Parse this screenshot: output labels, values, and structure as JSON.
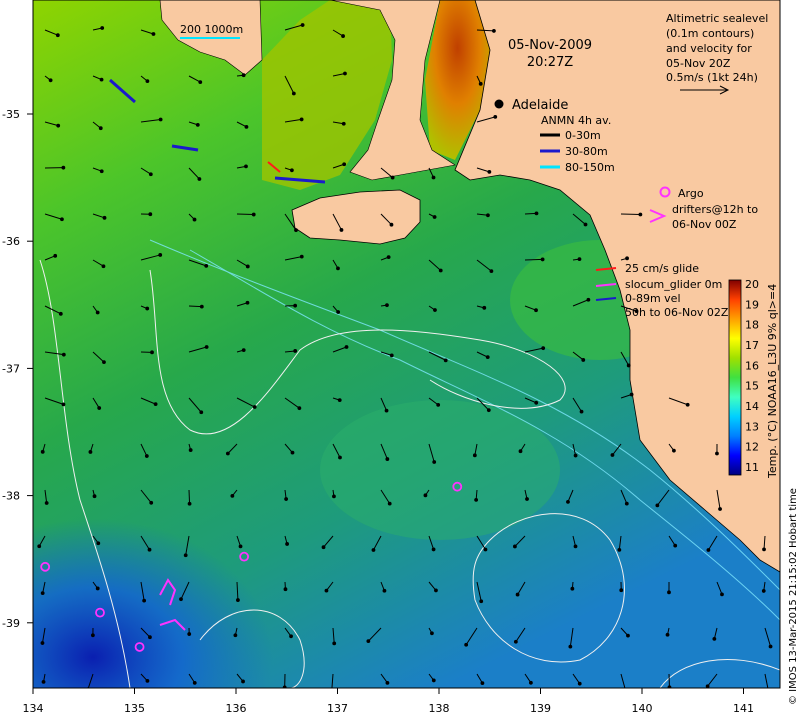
{
  "title": {
    "date": "05-Nov-2009",
    "time": "20:27Z"
  },
  "scale_bar": {
    "text": "200  1000m"
  },
  "city": {
    "name": "Adelaide"
  },
  "altimetry_note": {
    "lines": [
      "Altimetric sealevel",
      "(0.1m contours)",
      "and velocity for",
      "05-Nov 20Z",
      "0.5m/s (1kt 24h)"
    ]
  },
  "anmn_legend": {
    "title": "ANMN 4h av.",
    "entries": [
      {
        "label": "0-30m",
        "color": "#000000"
      },
      {
        "label": "30-80m",
        "color": "#1a1acc"
      },
      {
        "label": "80-150m",
        "color": "#00e5ff"
      }
    ]
  },
  "argo_legend": {
    "lines": [
      "Argo",
      "drifters@12h to",
      "06-Nov 00Z"
    ],
    "color": "#ff33ff"
  },
  "glider_legend": {
    "lines": [
      "25 cm/s glide",
      "slocum_glider 0m",
      "0-89m vel",
      "50h to 06-Nov 02Z"
    ],
    "colors": [
      "#ff1a1a",
      "#ff33ff",
      "#1a1acc"
    ]
  },
  "colorbar": {
    "label": "Temp. (°C) NOAA16_L3U 9% ql>=4",
    "ticks": [
      "11",
      "12",
      "13",
      "14",
      "15",
      "16",
      "17",
      "18",
      "19",
      "20"
    ],
    "colors": [
      "#00007f",
      "#0000ff",
      "#0080ff",
      "#00d0ff",
      "#40ffc0",
      "#40e040",
      "#a0e000",
      "#ffff00",
      "#ffa000",
      "#ff4000",
      "#800000"
    ]
  },
  "axes": {
    "x_ticks": [
      "134",
      "135",
      "136",
      "137",
      "138",
      "139",
      "140",
      "141"
    ],
    "y_ticks": [
      "-35",
      "-36",
      "-37",
      "-38",
      "-39"
    ]
  },
  "credit": {
    "text": "© IMOS 13-Mar-2015 21:15:02 Hobart time"
  },
  "argo_points": [
    {
      "lon": 138.18,
      "lat": -37.93
    },
    {
      "lon": 136.08,
      "lat": -38.48
    },
    {
      "lon": 134.12,
      "lat": -38.56
    },
    {
      "lon": 134.66,
      "lat": -38.92
    },
    {
      "lon": 135.05,
      "lat": -39.19
    }
  ],
  "colors": {
    "land": "#f9c9a1",
    "shelf": "#2fae3f",
    "deep": "#1f8fd8"
  }
}
